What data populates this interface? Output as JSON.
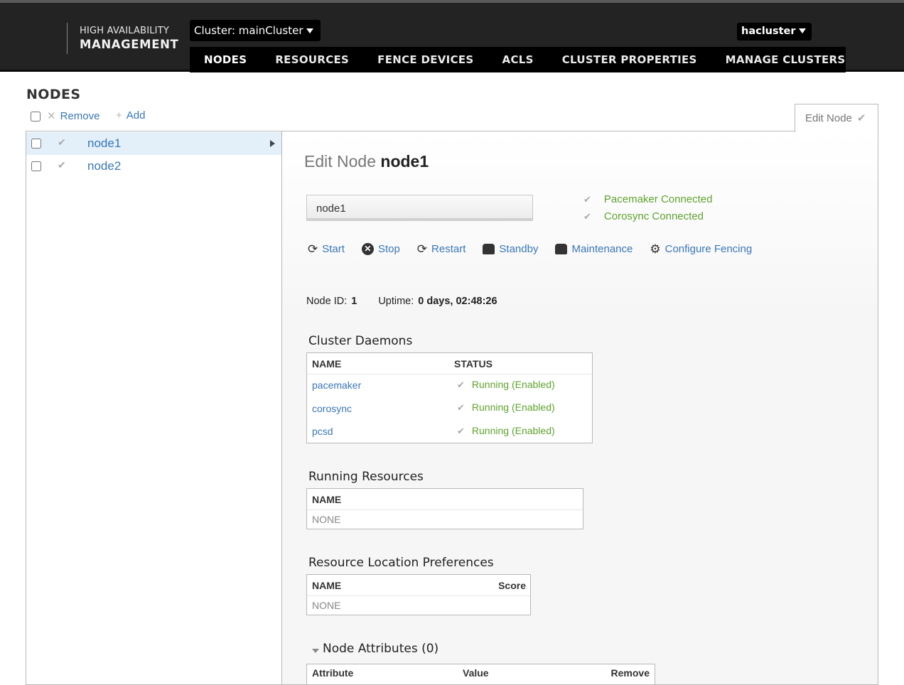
{
  "header": {
    "logo_line1": "HIGH AVAILABILITY",
    "logo_line2": "MANAGEMENT",
    "cluster_label": "Cluster: mainCluster",
    "user": "hacluster",
    "tabs": [
      {
        "label": "NODES",
        "active": true
      },
      {
        "label": "RESOURCES"
      },
      {
        "label": "FENCE DEVICES"
      },
      {
        "label": "ACLS"
      },
      {
        "label": "CLUSTER PROPERTIES"
      },
      {
        "label": "MANAGE CLUSTERS"
      }
    ]
  },
  "page": {
    "title": "NODES",
    "remove_label": "Remove",
    "add_label": "Add"
  },
  "nodes": [
    {
      "name": "node1",
      "selected": true
    },
    {
      "name": "node2",
      "selected": false
    }
  ],
  "edit": {
    "tab_label": "Edit Node",
    "title_prefix": "Edit Node",
    "title_node": "node1",
    "name_value": "node1",
    "status": [
      "Pacemaker Connected",
      "Corosync Connected"
    ],
    "actions": [
      "Start",
      "Stop",
      "Restart",
      "Standby",
      "Maintenance",
      "Configure Fencing"
    ],
    "node_id_label": "Node ID:",
    "node_id": "1",
    "uptime_label": "Uptime:",
    "uptime": "0 days, 02:48:26"
  },
  "daemons": {
    "title": "Cluster Daemons",
    "col_name": "NAME",
    "col_status": "STATUS",
    "rows": [
      {
        "name": "pacemaker",
        "status": "Running (Enabled)"
      },
      {
        "name": "corosync",
        "status": "Running (Enabled)"
      },
      {
        "name": "pcsd",
        "status": "Running (Enabled)"
      }
    ]
  },
  "resources": {
    "title": "Running Resources",
    "col_name": "NAME",
    "empty": "NONE"
  },
  "preferences": {
    "title": "Resource Location Preferences",
    "col_name": "NAME",
    "col_score": "Score",
    "empty": "NONE"
  },
  "attributes": {
    "title": "Node Attributes (0)",
    "col_attribute": "Attribute",
    "col_value": "Value",
    "col_remove": "Remove"
  }
}
